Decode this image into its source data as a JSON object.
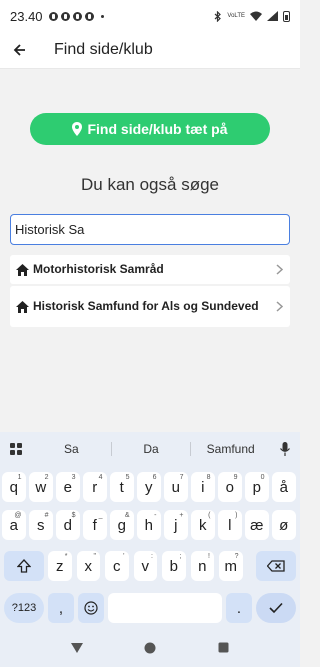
{
  "status_bar": {
    "time": "23.40",
    "right_text": "VoLTE"
  },
  "header": {
    "title": "Find side/klub"
  },
  "main": {
    "find_nearby_label": "Find side/klub tæt på",
    "search_heading": "Du kan også søge",
    "search_value": "Historisk Sa",
    "results": [
      {
        "label": "Motorhistorisk Samråd",
        "icon": "home-icon"
      },
      {
        "label": "Historisk Samfund for Als og Sundeved",
        "icon": "home-icon"
      }
    ]
  },
  "keyboard": {
    "suggestions": [
      "Sa",
      "Da",
      "Samfund"
    ],
    "row1": [
      {
        "k": "q",
        "s": "1"
      },
      {
        "k": "w",
        "s": "2"
      },
      {
        "k": "e",
        "s": "3"
      },
      {
        "k": "r",
        "s": "4"
      },
      {
        "k": "t",
        "s": "5"
      },
      {
        "k": "y",
        "s": "6"
      },
      {
        "k": "u",
        "s": "7"
      },
      {
        "k": "i",
        "s": "8"
      },
      {
        "k": "o",
        "s": "9"
      },
      {
        "k": "p",
        "s": "0"
      },
      {
        "k": "å",
        "s": ""
      }
    ],
    "row2": [
      {
        "k": "a",
        "s": "@"
      },
      {
        "k": "s",
        "s": "#"
      },
      {
        "k": "d",
        "s": "$"
      },
      {
        "k": "f",
        "s": "_"
      },
      {
        "k": "g",
        "s": "&"
      },
      {
        "k": "h",
        "s": "-"
      },
      {
        "k": "j",
        "s": "+"
      },
      {
        "k": "k",
        "s": "("
      },
      {
        "k": "l",
        "s": ")"
      },
      {
        "k": "æ",
        "s": ""
      },
      {
        "k": "ø",
        "s": ""
      }
    ],
    "row3": [
      {
        "k": "z",
        "s": "*"
      },
      {
        "k": "x",
        "s": "\""
      },
      {
        "k": "c",
        "s": "'"
      },
      {
        "k": "v",
        "s": ":"
      },
      {
        "k": "b",
        "s": ";"
      },
      {
        "k": "n",
        "s": "!"
      },
      {
        "k": "m",
        "s": "?"
      }
    ],
    "sym_label": "?123",
    "comma": ",",
    "period": "."
  }
}
